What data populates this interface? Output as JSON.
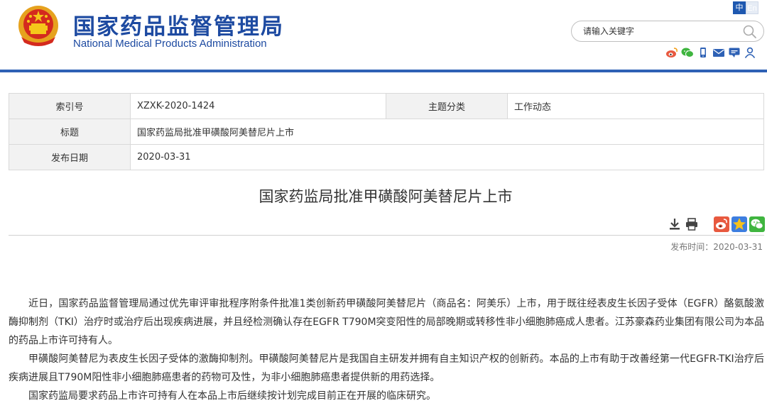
{
  "header": {
    "title_cn": "国家药品监督管理局",
    "title_en": "National Medical Products Administration",
    "lang_cn": "中",
    "lang_en": "En",
    "search_placeholder": "请输入关键字",
    "social_icons": [
      "weibo-icon",
      "wechat-icon",
      "mobile-icon",
      "mail-icon",
      "message-icon",
      "user-icon"
    ]
  },
  "info_table": {
    "index_label": "索引号",
    "index_value": "XZXK-2020-1424",
    "topic_label": "主题分类",
    "topic_value": "工作动态",
    "title_label": "标题",
    "title_value": "国家药监局批准甲磺酸阿美替尼片上市",
    "date_label": "发布日期",
    "date_value": "2020-03-31"
  },
  "article": {
    "title": "国家药监局批准甲磺酸阿美替尼片上市",
    "publish_label": "发布时间：",
    "publish_date": "2020-03-31",
    "paragraphs": [
      "近日，国家药品监督管理局通过优先审评审批程序附条件批准1类创新药甲磺酸阿美替尼片（商品名：阿美乐）上市，用于既往经表皮生长因子受体（EGFR）酪氨酸激酶抑制剂（TKI）治疗时或治疗后出现疾病进展，并且经检测确认存在EGFR T790M突变阳性的局部晚期或转移性非小细胞肺癌成人患者。江苏豪森药业集团有限公司为本品的药品上市许可持有人。",
      "甲磺酸阿美替尼为表皮生长因子受体的激酶抑制剂。甲磺酸阿美替尼片是我国自主研发并拥有自主知识产权的创新药。本品的上市有助于改善经第一代EGFR-TKI治疗后疾病进展且T790M阳性非小细胞肺癌患者的药物可及性，为非小细胞肺癌患者提供新的用药选择。",
      "国家药监局要求药品上市许可持有人在本品上市后继续按计划完成目前正在开展的临床研究。"
    ]
  },
  "colors": {
    "brand_blue": "#1d4aa1",
    "rule_blue": "#2e61b5",
    "weibo_orange": "#e8593f",
    "favorite_blue": "#3d7ee0",
    "wechat_green": "#3fb53f"
  }
}
